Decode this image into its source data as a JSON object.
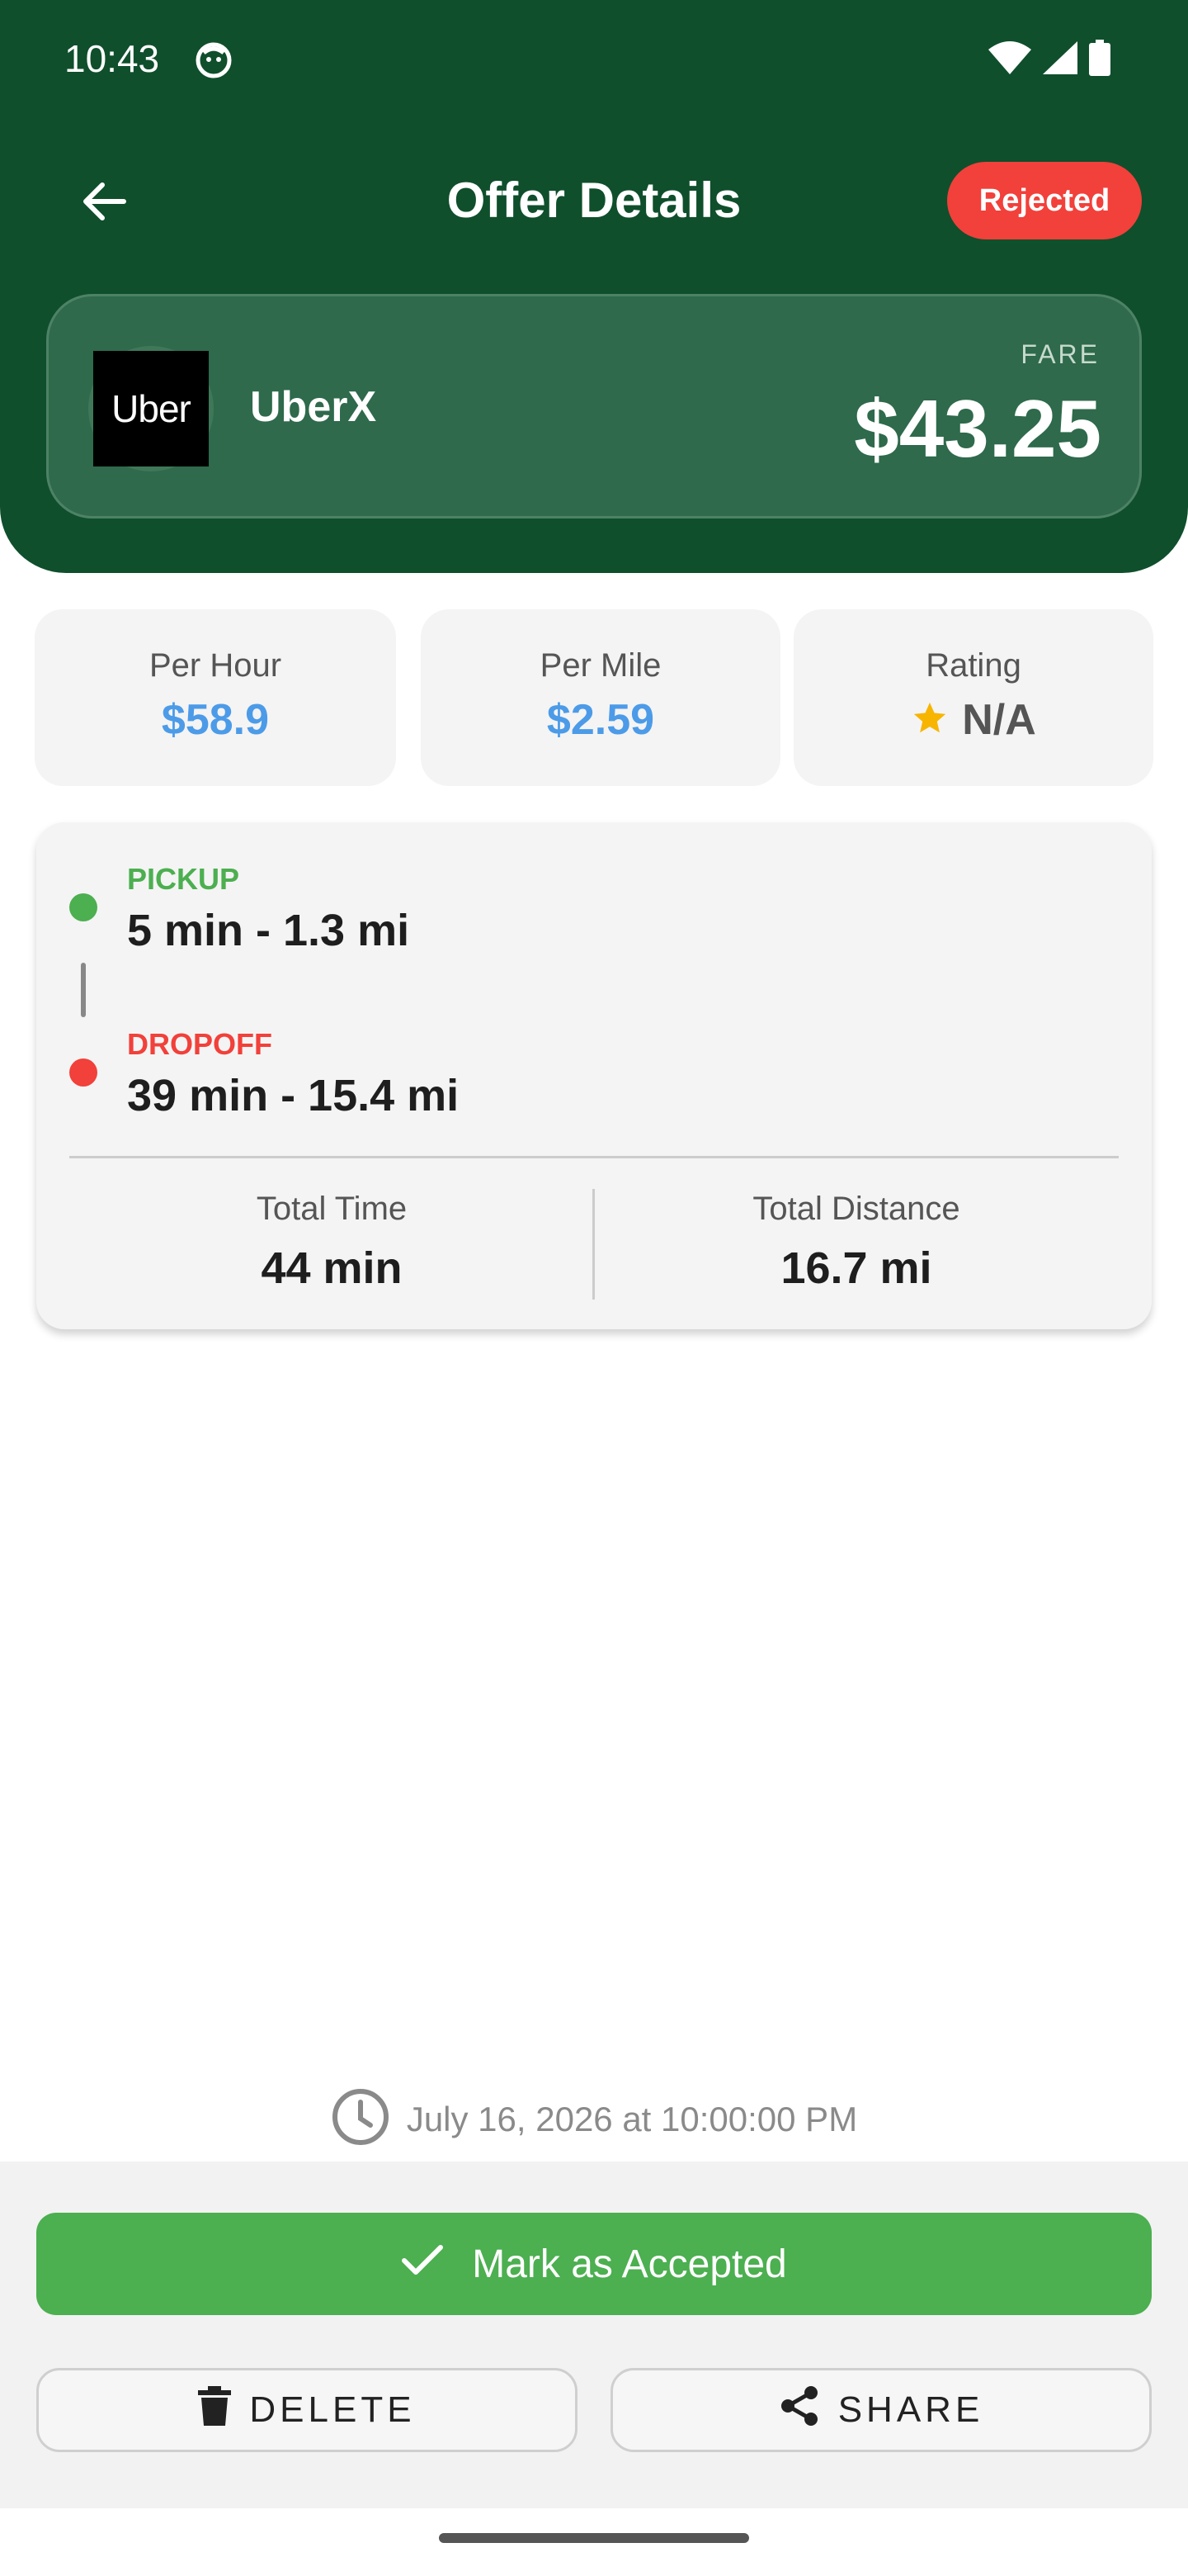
{
  "status_bar": {
    "time": "10:43",
    "icons": [
      "face-icon",
      "wifi-icon",
      "signal-icon",
      "battery-icon"
    ]
  },
  "header": {
    "title": "Offer Details",
    "status_badge": "Rejected",
    "colors": {
      "background": "#0f4f2c",
      "badge": "#f2403a"
    }
  },
  "fare_card": {
    "logo_text": "Uber",
    "service": "UberX",
    "fare_label": "FARE",
    "fare": "$43.25"
  },
  "stats": {
    "per_hour": {
      "label": "Per Hour",
      "value": "$58.9"
    },
    "per_mile": {
      "label": "Per Mile",
      "value": "$2.59"
    },
    "rating": {
      "label": "Rating",
      "value": "N/A"
    }
  },
  "trip": {
    "pickup": {
      "label": "PICKUP",
      "value": "5 min - 1.3 mi"
    },
    "dropoff": {
      "label": "DROPOFF",
      "value": "39 min - 15.4 mi"
    },
    "total_time": {
      "label": "Total Time",
      "value": "44 min"
    },
    "total_distance": {
      "label": "Total Distance",
      "value": "16.7 mi"
    }
  },
  "timestamp": "July 16, 2026 at 10:00:00 PM",
  "actions": {
    "accept": "Mark as Accepted",
    "delete": "DELETE",
    "share": "SHARE"
  },
  "colors": {
    "accent_green": "#4caf50",
    "accent_red": "#f2403a",
    "stat_blue": "#4c9be8",
    "star": "#f7b500"
  }
}
